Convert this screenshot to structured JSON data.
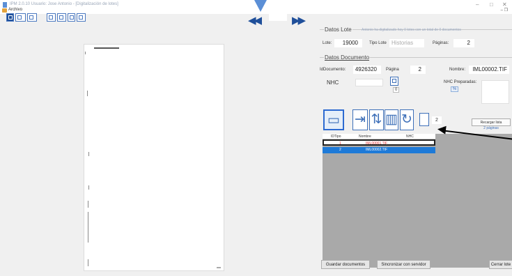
{
  "window": {
    "title": "IPM 2.0.10  Usuario: Jose Antonio - [Digitalización de lotes]",
    "menu": "Archivo",
    "minimize": "–",
    "maximize": "□",
    "close": "✕",
    "menu_right": "– ❐"
  },
  "toolbar": {
    "items": [
      "page-1-icon",
      "page-1-2-icon",
      "grid-icon",
      "fit-page-icon",
      "fit-width-icon",
      "single-page-icon",
      "thumbnail-icon"
    ],
    "nav_first": "◀◀",
    "nav_last": "▶▶"
  },
  "lote": {
    "title": "Datos Lote",
    "notice": "Antonio ha digitalizado hoy 0 lotes con un total de 0 documentos",
    "lote_label": "Lote:",
    "lote_value": "19000",
    "tipo_label": "Tipo Lote",
    "tipo_value": "Historias",
    "paginas_label": "Páginas:",
    "paginas_value": "2"
  },
  "documento": {
    "title": "Datos Documento",
    "id_label": "IdDocumento:",
    "id_value": "4926320",
    "pagina_label": "Página",
    "pagina_value": "2",
    "nombre_label": "Nombre:",
    "nombre_value": "IML00002.TIF",
    "nhc_label": "NHC",
    "stepper_value": "0",
    "nhc_preparadas_label": "NHC Preparadas:",
    "pct_label": "%",
    "page_count": "2",
    "recargar_label": "Recargar lista",
    "recargar_sub": "2 páginas"
  },
  "grid": {
    "headers": [
      "IDTipo",
      "Nombre",
      "NHC"
    ],
    "rows": [
      {
        "id": "1",
        "nombre": "IML00001.TIF",
        "nhc": ""
      },
      {
        "id": "2",
        "nombre": "IML00002.TIF",
        "nhc": ""
      }
    ]
  },
  "buttons": {
    "guardar": "Guardar documentos",
    "sincronizar": "Sincronizar con servidor",
    "cerrar": "Cerrar lote"
  }
}
